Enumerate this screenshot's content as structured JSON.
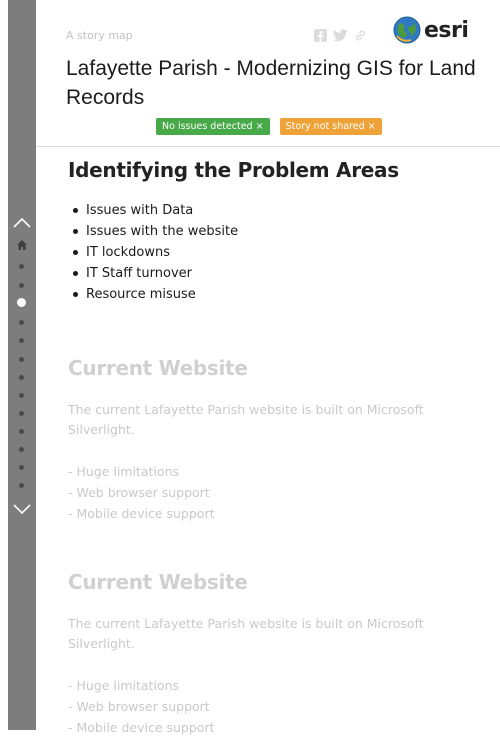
{
  "header": {
    "kicker": "A story map",
    "title": "Lafayette Parish - Modernizing GIS for Land Records",
    "brand": "esri",
    "badges": [
      {
        "label": "No issues detected ×",
        "color": "#48a948"
      },
      {
        "label": "Story not shared ×",
        "color": "#eda338"
      }
    ],
    "share_icons": [
      "facebook-icon",
      "twitter-icon",
      "link-icon"
    ]
  },
  "nav": {
    "icons": [
      "chevron-up-icon",
      "home-icon",
      "chevron-down-icon"
    ],
    "active_dot_index": 2
  },
  "section1": {
    "title": "Identifying the Problem Areas",
    "items": [
      "Issues with Data",
      "Issues with the website",
      "IT lockdowns",
      "IT Staff turnover",
      "Resource misuse"
    ]
  },
  "section2": {
    "title": "Current Website",
    "paragraph": "The current Lafayette Parish website is built on Microsoft Silverlight.",
    "items": [
      "- Huge limitations",
      "- Web browser support",
      "- Mobile device support"
    ]
  },
  "section3": {
    "title": "Current Website",
    "paragraph": "The current Lafayette Parish website is built on Microsoft Silverlight.",
    "items": [
      "- Huge limitations",
      "- Web browser support",
      "- Mobile device support"
    ]
  }
}
